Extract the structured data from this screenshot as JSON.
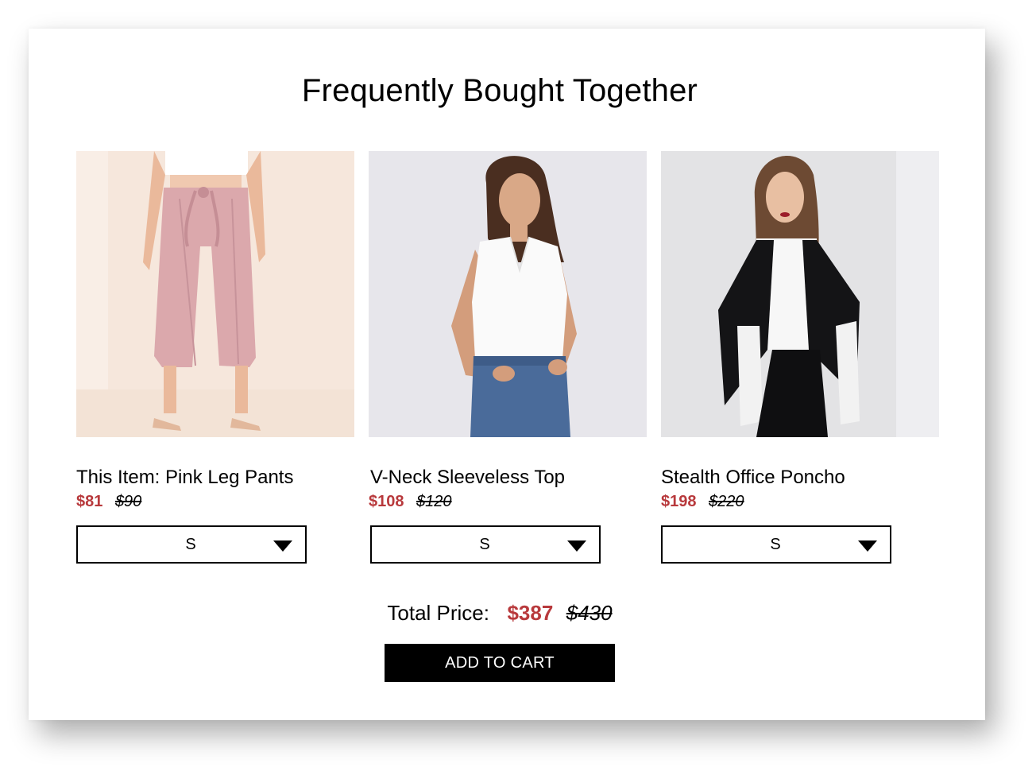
{
  "heading": "Frequently Bought Together",
  "products": [
    {
      "name": "This Item: Pink Leg Pants",
      "price": "$81",
      "old_price": "$90",
      "size": "S",
      "image_alt": "model wearing pink wide-leg pants"
    },
    {
      "name": "V-Neck Sleeveless Top",
      "price": "$108",
      "old_price": "$120",
      "size": "S",
      "image_alt": "model wearing white sleeveless v-neck top"
    },
    {
      "name": "Stealth Office Poncho",
      "price": "$198",
      "old_price": "$220",
      "size": "S",
      "image_alt": "model wearing black poncho blazer"
    }
  ],
  "total": {
    "label": "Total Price:",
    "price": "$387",
    "old_price": "$430"
  },
  "add_to_cart_label": "ADD TO CART",
  "colors": {
    "sale_price": "#b8393c",
    "button_bg": "#000000",
    "button_text": "#ffffff"
  }
}
